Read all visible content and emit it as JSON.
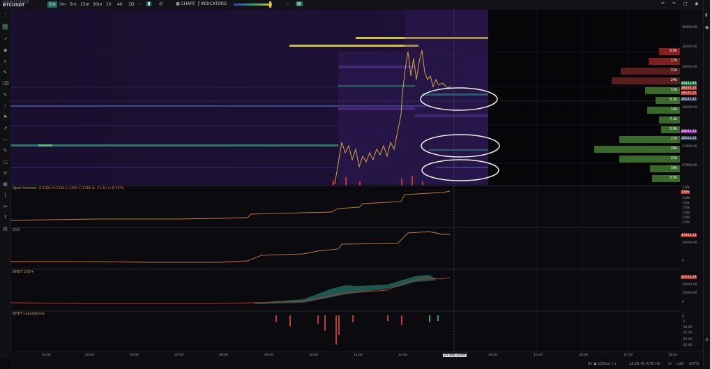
{
  "symbol": {
    "exchange": "BINANCE FUTURES",
    "ticker": "BTCUSDT"
  },
  "timeframes": [
    {
      "label": "1m",
      "active": true
    },
    {
      "label": "3m"
    },
    {
      "label": "5m"
    },
    {
      "label": "15m"
    },
    {
      "label": "30m"
    },
    {
      "label": "1h"
    },
    {
      "label": "4h"
    },
    {
      "label": "1D"
    }
  ],
  "toolbar": {
    "chart_label": "CHART",
    "indicators_label": "INDICATORS"
  },
  "price_axis": [
    "28400.00",
    "28300.00",
    "28200.00",
    "28100.00",
    "28000.00",
    "27900.00",
    "27800.00"
  ],
  "price_tags": [
    {
      "text": "28221.83",
      "color": "#1c8f4a"
    },
    {
      "text": "28205.25",
      "color": "#c0392b"
    },
    {
      "text": "28182.05",
      "color": "#c0392b"
    },
    {
      "text": "28157.47",
      "color": "#3b4c6b"
    },
    {
      "text": "28062.20",
      "color": "#9a2fb0"
    },
    {
      "text": "28016.25",
      "color": "#3b4c6b"
    }
  ],
  "volume_profile": [
    "6.6k",
    "17k",
    "21k",
    "24k",
    "13k",
    "8.2k",
    "14k",
    "7.1k",
    "5.9k",
    "21k",
    "29k",
    "21k",
    "10k",
    "5.5k"
  ],
  "panes": {
    "oi": {
      "label": "Open Interest",
      "stats": "O:136k H:136k L:136k C:136k Δ: 11.4k (+8.43%)",
      "axis": [
        "136k",
        "134k",
        "132k",
        "130k",
        "128k",
        "126k",
        "124k",
        "122k",
        "121k"
      ],
      "tag": "136k"
    },
    "cvd": {
      "label": "CVD",
      "axis": [
        "40000.00",
        "20000.00",
        "0"
      ],
      "tag": "47952.45"
    },
    "bybit_cvd": {
      "label": "BYBIT CVD+",
      "axis": [
        "20000.00",
        "10000.00",
        "0"
      ],
      "tag": "20732.09"
    },
    "liq": {
      "label": "BYBIT Liquidations",
      "axis": [
        "0",
        "-5",
        "-10.00",
        "-15.00",
        "-20.00",
        "-25.00"
      ]
    }
  },
  "time_axis": [
    "04:00",
    "05:00",
    "06:00",
    "07:00",
    "08:00",
    "09:00",
    "10:00",
    "11:00",
    "12:00",
    "13:00",
    "14:00",
    "15:00",
    "16:00",
    "17:00",
    "18:00"
  ],
  "crosshair_time": "27 Sep 13:09",
  "status": {
    "conn": "81 ▣ 128ms ↑↓",
    "clock": "13:03:45 (UTC+8)",
    "pct": "%",
    "log": "LOG",
    "auto": "AUTO"
  }
}
